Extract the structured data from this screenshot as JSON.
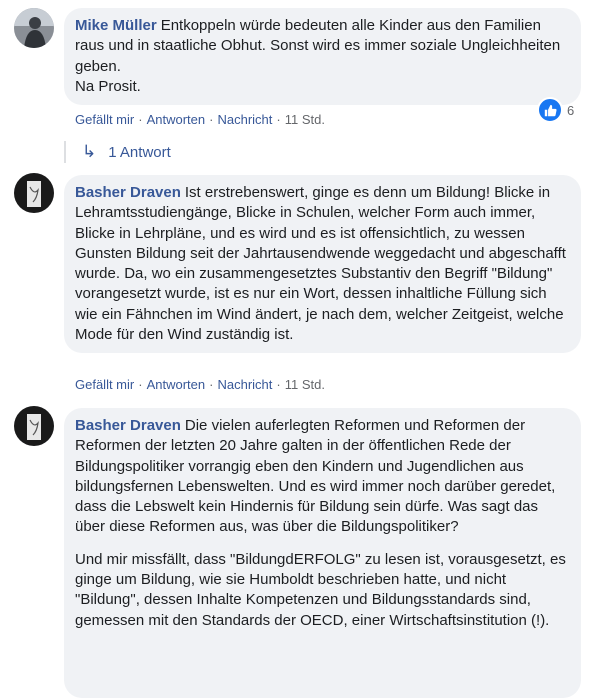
{
  "comments": [
    {
      "author": "Mike Müller",
      "text": "Entkoppeln würde bedeuten alle Kinder aus den Familien raus und in staatliche Obhut. Sonst wird es immer soziale Ungleichheiten geben.",
      "text2": "Na Prosit.",
      "like": "Gefällt mir",
      "reply": "Antworten",
      "message": "Nachricht",
      "time": "11 Std.",
      "reaction_count": "6",
      "replies_label": "1 Antwort"
    },
    {
      "author": "Basher Draven",
      "text": "Ist erstrebenswert, ginge es denn um Bildung! Blicke in Lehramtsstudiengänge, Blicke in Schulen, welcher Form auch immer, Blicke in Lehrpläne, und es wird und es ist offensichtlich, zu wessen Gunsten Bildung seit der Jahrtausendwende weggedacht und abgeschafft wurde. Da, wo ein zusammengesetztes Substantiv den Begriff \"Bildung\" vorangesetzt wurde, ist es nur ein Wort, dessen inhaltliche Füllung sich wie ein Fähnchen im Wind ändert, je nach dem, welcher Zeitgeist, welche Mode für den Wind zuständig ist.",
      "like": "Gefällt mir",
      "reply": "Antworten",
      "message": "Nachricht",
      "time": "11 Std."
    },
    {
      "author": "Basher Draven",
      "text": "Die vielen auferlegten Reformen und Reformen der Reformen der letzten 20 Jahre galten in der öffentlichen Rede der Bildungspolitiker vorrangig eben den Kindern und Jugendlichen aus bildungsfernen Lebenswelten. Und es wird immer noch darüber geredet, dass die Lebswelt kein Hindernis für Bildung sein dürfe. Was sagt das über diese Reformen aus, was über die Bildungspolitiker?",
      "text2": "Und mir missfällt, dass \"BildungdERFOLG\" zu lesen ist, vorausgesetzt, es ginge um Bildung, wie sie Humboldt beschrieben hatte, und nicht \"Bildung\", dessen Inhalte Kompetenzen und Bildungsstandards sind, gemessen mit den Standards der OECD, einer Wirtschaftsinstitution (!)."
    }
  ],
  "colors": {
    "name": "#385898",
    "bubble": "#f0f2f5",
    "meta": "#65676b",
    "like": "#1877f2"
  },
  "icons": {
    "reaction": "thumbs-up-icon",
    "reply_arrow": "reply-arrow-icon"
  }
}
